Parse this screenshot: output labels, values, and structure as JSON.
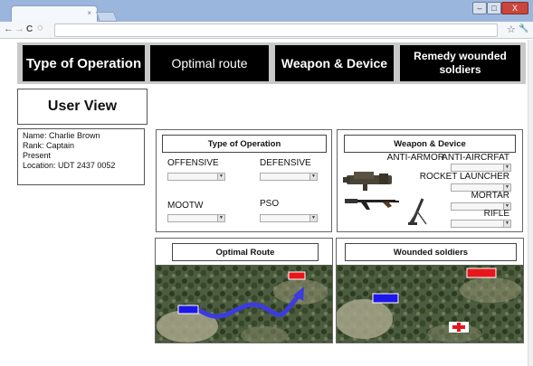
{
  "browser": {
    "tab_close": "×",
    "window_minimize": "–",
    "window_maximize": "□",
    "window_close": "X",
    "back": "←",
    "forward": "→",
    "reload": "C",
    "star": "☆",
    "wrench": "🔧"
  },
  "nav": {
    "type_of_operation": "Type of Operation",
    "optimal_route": "Optimal route",
    "weapon_device": "Weapon & Device",
    "remedy_wounded": "Remedy wounded soldiers"
  },
  "user_view": {
    "title": "User View",
    "name": "Name: Charlie Brown",
    "rank": "Rank: Captain",
    "status": "Present",
    "location": "Location: UDT 2437 0052"
  },
  "type_of_operation": {
    "title": "Type of Operation",
    "offensive": "OFFENSIVE",
    "defensive": "DEFENSIVE",
    "mootw": "MOOTW",
    "pso": "PSO"
  },
  "weapon_device": {
    "title": "Weapon & Device",
    "anti_armor": "ANTI-ARMOR",
    "anti_aircraft": "ANTI-AIRCRFAT",
    "rocket_launcher": "ROCKET LAUNCHER",
    "mortar": "MORTAR",
    "rifle": "RIFLE"
  },
  "optimal_route": {
    "title": "Optimal Route"
  },
  "wounded_soldiers": {
    "title": "Wounded soldiers"
  },
  "colors": {
    "nav_bg": "#000000",
    "nav_strip": "#c9c9c9",
    "friendly_marker": "#1d16e8",
    "target_marker": "#e8161b",
    "route_arrow": "#3b3be0"
  }
}
